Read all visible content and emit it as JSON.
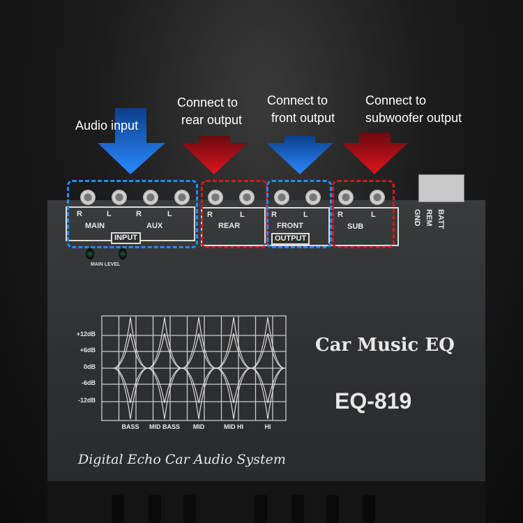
{
  "callouts": {
    "audio_input": "Audio input",
    "rear": [
      "Connect to",
      "rear output"
    ],
    "front": [
      "Connect to",
      "front output"
    ],
    "sub": [
      "Connect to",
      "subwoofer output"
    ]
  },
  "colors": {
    "input_arrow": "#1e6fd6",
    "output_arrow_rear": "#c5121a",
    "output_front": "#1e6fd6",
    "output_sub": "#c5121a"
  },
  "panel": {
    "main": {
      "r": "R",
      "l": "L",
      "label": "MAIN"
    },
    "aux": {
      "r": "R",
      "l": "L",
      "label": "AUX"
    },
    "input_tag": "INPUT",
    "rear": {
      "r": "R",
      "l": "L",
      "label": "REAR"
    },
    "front": {
      "r": "R",
      "l": "L",
      "label": "FRONT"
    },
    "output_tag": "OUTPUT",
    "sub": {
      "r": "R",
      "l": "L",
      "label": "SUB"
    },
    "power": [
      "GND",
      "REM",
      "BATT"
    ],
    "main_level": "MAIN LEVEL"
  },
  "eq_graph": {
    "y_ticks": [
      "+12dB",
      "+6dB",
      "0dB",
      "-6dB",
      "-12dB"
    ],
    "bands": [
      "BASS",
      "MID BASS",
      "MID",
      "MID HI",
      "HI"
    ]
  },
  "product": {
    "name": "Car Music EQ",
    "model": "EQ-819",
    "tagline": "Digital Echo Car Audio System"
  }
}
